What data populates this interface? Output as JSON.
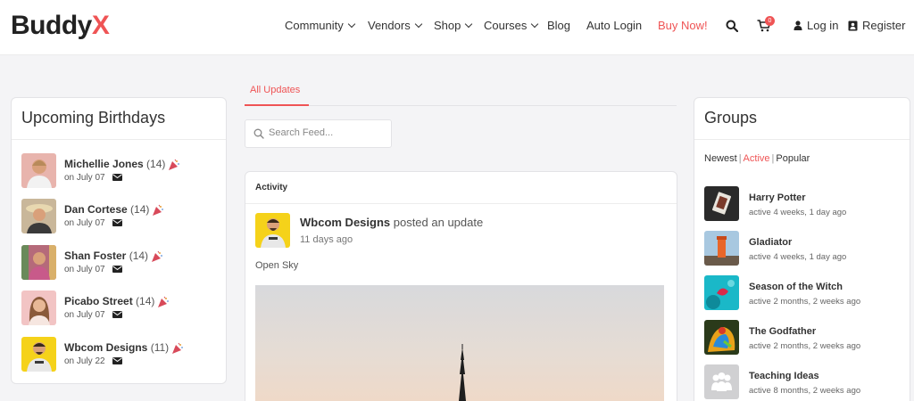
{
  "brand": {
    "name_main": "Buddy",
    "name_accent": "X",
    "accent_color": "#ef5455"
  },
  "nav": {
    "items": [
      {
        "label": "Community",
        "dropdown": true
      },
      {
        "label": "Vendors",
        "dropdown": true
      },
      {
        "label": "Shop",
        "dropdown": true
      },
      {
        "label": "Courses",
        "dropdown": true
      },
      {
        "label": "Blog",
        "dropdown": false
      },
      {
        "label": "Auto Login",
        "dropdown": false
      },
      {
        "label": "Buy Now!",
        "dropdown": false
      }
    ],
    "search_icon": "search-icon",
    "cart_count": "0",
    "login_label": "Log in",
    "register_label": "Register"
  },
  "birthdays": {
    "title": "Upcoming Birthdays",
    "items": [
      {
        "name": "Michellie Jones",
        "count": "(14)",
        "date": "on July 07"
      },
      {
        "name": "Dan Cortese",
        "count": "(14)",
        "date": "on July 07"
      },
      {
        "name": "Shan Foster",
        "count": "(14)",
        "date": "on July 07"
      },
      {
        "name": "Picabo Street",
        "count": "(14)",
        "date": "on July 07"
      },
      {
        "name": "Wbcom Designs",
        "count": "(11)",
        "date": "on July 22"
      }
    ]
  },
  "feed": {
    "tab_label": "All Updates",
    "search_placeholder": "Search Feed...",
    "activity": {
      "heading": "Activity",
      "author": "Wbcom Designs",
      "action": " posted an update",
      "time": "11 days ago",
      "text": "Open Sky"
    }
  },
  "groups": {
    "title": "Groups",
    "filters": {
      "newest": "Newest",
      "active": "Active",
      "popular": "Popular"
    },
    "items": [
      {
        "name": "Harry Potter",
        "active": "active 4 weeks, 1 day ago"
      },
      {
        "name": "Gladiator",
        "active": "active 4 weeks, 1 day ago"
      },
      {
        "name": "Season of the Witch",
        "active": "active 2 months, 2 weeks ago"
      },
      {
        "name": "The Godfather",
        "active": "active 2 months, 2 weeks ago"
      },
      {
        "name": "Teaching Ideas",
        "active": "active 8 months, 2 weeks ago"
      }
    ]
  }
}
